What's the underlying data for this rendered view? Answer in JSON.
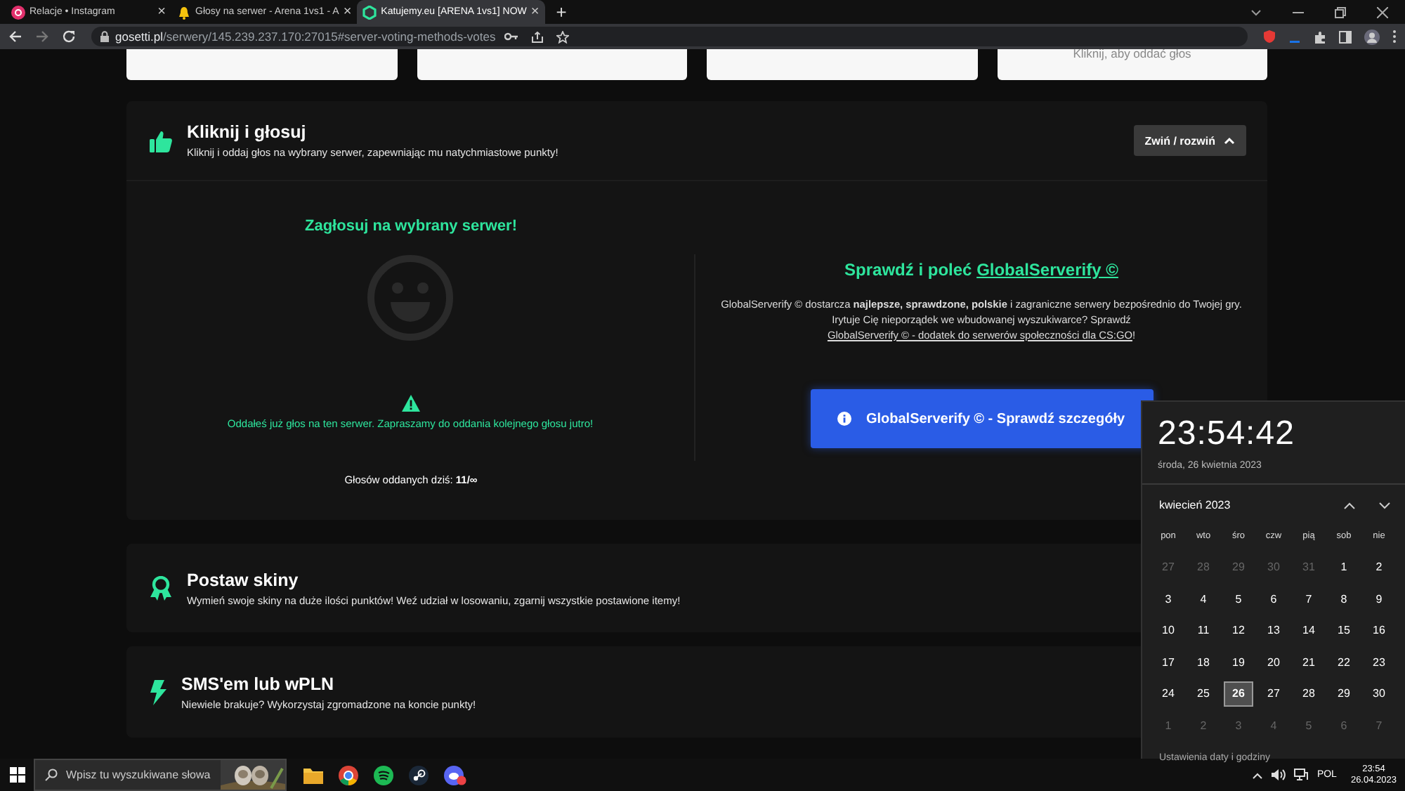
{
  "browser": {
    "tabs": [
      {
        "title": "Relacje • Instagram",
        "selected": false
      },
      {
        "title": "Głosy na serwer - Arena 1vs1 - A",
        "selected": false
      },
      {
        "title": "Katujemy.eu [ARENA 1vs1] NOW",
        "selected": true
      }
    ],
    "close_mark": "×",
    "new_tab": "+",
    "url_domain": "gosetti.pl",
    "url_path": "/serwery/145.239.237.170:27015#server-voting-methods-votes"
  },
  "top_cards": [
    {
      "kind": "blank"
    },
    {
      "kind": "blank"
    },
    {
      "kind": "blank"
    },
    {
      "kind": "label",
      "text": "Kliknij, aby oddać głos"
    }
  ],
  "vote_section": {
    "title": "Kliknij i głosuj",
    "subtitle": "Kliknij i oddaj głos na wybrany serwer, zapewniając mu natychmiastowe punkty!",
    "toggle_button": "Zwiń / rozwiń",
    "expanded": true,
    "vote_heading": "Zagłosuj na wybrany serwer!",
    "vote_message": "Oddałeś już głos na ten serwer. Zapraszamy do oddania kolejnego głosu jutro!",
    "votes_today": "Głosów oddanych dziś: **11/∞**",
    "promo_heading": "Sprawdź i poleć",
    "promo_heading_link": "GlobalServerify ©",
    "promo_text": "GlobalServerify © dostarcza **najlepsze, sprawdzone, polskie** i zagraniczne serwery bezpośrednio do Twojej gry. Irytuje Cię nieporządek we wbudowanej wyszukiwarce? Sprawdź",
    "promo_text_link": "GlobalServerify © - dodatek do serwerów społeczności dla CS:GO",
    "promo_text_end": "!",
    "promo_button": "GlobalServerify © - Sprawdź szczegóły"
  },
  "sections": [
    {
      "kind": "award",
      "title": "Postaw skiny",
      "subtitle": "Wymień swoje skiny na duże ilości punktów! Weź udział w losowaniu, zgarnij wszystkie postawione itemy!"
    },
    {
      "kind": "bolt",
      "title": "SMS'em lub wPLN",
      "subtitle": "Niewiele brakuje? Wykorzystaj zgromadzone na koncie punkty!"
    }
  ],
  "clock": {
    "time": "23:54:42",
    "date": "środa, 26 kwietnia 2023",
    "month": "kwiecień 2023",
    "weekdays": [
      "pon",
      "wto",
      "śro",
      "czw",
      "pią",
      "sob",
      "nie"
    ],
    "days": [
      {
        "label": "27",
        "in_month": false,
        "selected": false
      },
      {
        "label": "28",
        "in_month": false,
        "selected": false
      },
      {
        "label": "29",
        "in_month": false,
        "selected": false
      },
      {
        "label": "30",
        "in_month": false,
        "selected": false
      },
      {
        "label": "31",
        "in_month": false,
        "selected": false
      },
      {
        "label": "1",
        "in_month": true,
        "selected": false
      },
      {
        "label": "2",
        "in_month": true,
        "selected": false
      },
      {
        "label": "3",
        "in_month": true,
        "selected": false
      },
      {
        "label": "4",
        "in_month": true,
        "selected": false
      },
      {
        "label": "5",
        "in_month": true,
        "selected": false
      },
      {
        "label": "6",
        "in_month": true,
        "selected": false
      },
      {
        "label": "7",
        "in_month": true,
        "selected": false
      },
      {
        "label": "8",
        "in_month": true,
        "selected": false
      },
      {
        "label": "9",
        "in_month": true,
        "selected": false
      },
      {
        "label": "10",
        "in_month": true,
        "selected": false
      },
      {
        "label": "11",
        "in_month": true,
        "selected": false
      },
      {
        "label": "12",
        "in_month": true,
        "selected": false
      },
      {
        "label": "13",
        "in_month": true,
        "selected": false
      },
      {
        "label": "14",
        "in_month": true,
        "selected": false
      },
      {
        "label": "15",
        "in_month": true,
        "selected": false
      },
      {
        "label": "16",
        "in_month": true,
        "selected": false
      },
      {
        "label": "17",
        "in_month": true,
        "selected": false
      },
      {
        "label": "18",
        "in_month": true,
        "selected": false
      },
      {
        "label": "19",
        "in_month": true,
        "selected": false
      },
      {
        "label": "20",
        "in_month": true,
        "selected": false
      },
      {
        "label": "21",
        "in_month": true,
        "selected": false
      },
      {
        "label": "22",
        "in_month": true,
        "selected": false
      },
      {
        "label": "23",
        "in_month": true,
        "selected": false
      },
      {
        "label": "24",
        "in_month": true,
        "selected": false
      },
      {
        "label": "25",
        "in_month": true,
        "selected": false
      },
      {
        "label": "26",
        "in_month": true,
        "selected": true
      },
      {
        "label": "27",
        "in_month": true,
        "selected": false
      },
      {
        "label": "28",
        "in_month": true,
        "selected": false
      },
      {
        "label": "29",
        "in_month": true,
        "selected": false
      },
      {
        "label": "30",
        "in_month": true,
        "selected": false
      },
      {
        "label": "1",
        "in_month": false,
        "selected": false
      },
      {
        "label": "2",
        "in_month": false,
        "selected": false
      },
      {
        "label": "3",
        "in_month": false,
        "selected": false
      },
      {
        "label": "4",
        "in_month": false,
        "selected": false
      },
      {
        "label": "5",
        "in_month": false,
        "selected": false
      },
      {
        "label": "6",
        "in_month": false,
        "selected": false
      },
      {
        "label": "7",
        "in_month": false,
        "selected": false
      }
    ],
    "settings_link": "Ustawienia daty i godziny"
  },
  "taskbar": {
    "search_placeholder": "Wpisz tu wyszukiwane słowa",
    "language": "POL",
    "time": "23:54",
    "date": "26.04.2023"
  }
}
